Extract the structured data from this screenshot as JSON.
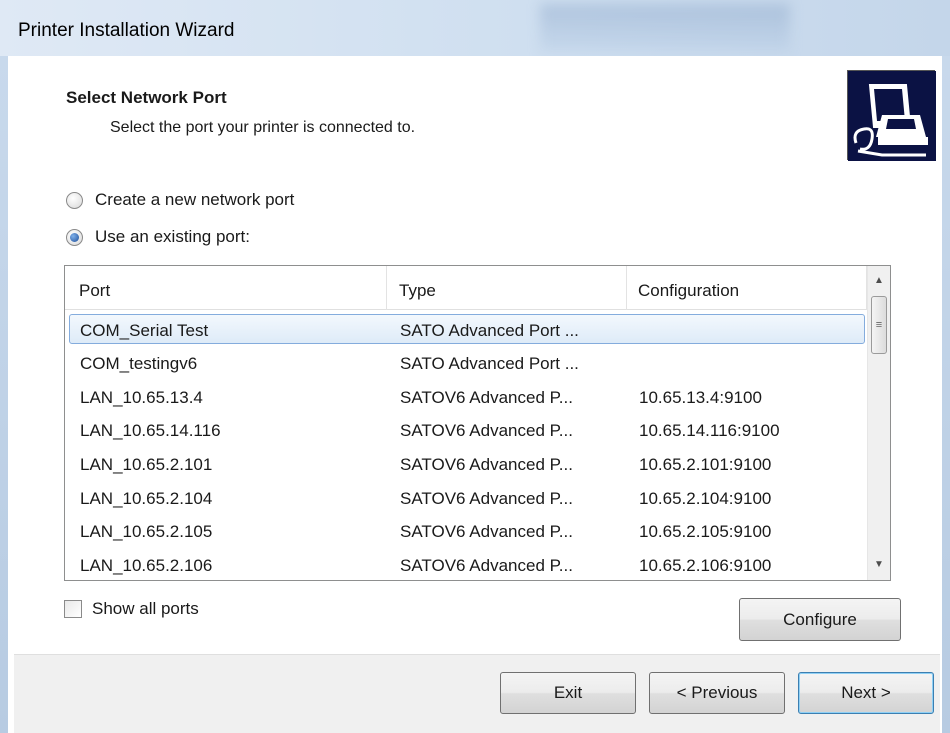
{
  "window": {
    "title": "Printer Installation Wizard"
  },
  "header": {
    "title": "Select Network Port",
    "subtitle": "Select the port your printer is connected to."
  },
  "options": {
    "create_new": "Create a new network port",
    "use_existing": "Use an existing port:",
    "selected": "use_existing"
  },
  "ports": {
    "columns": [
      "Port",
      "Type",
      "Configuration"
    ],
    "selected_index": 0,
    "rows": [
      {
        "port": "COM_Serial Test",
        "type": "SATO Advanced Port ...",
        "config": ""
      },
      {
        "port": "COM_testingv6",
        "type": "SATO Advanced Port ...",
        "config": ""
      },
      {
        "port": "LAN_10.65.13.4",
        "type": "SATOV6 Advanced P...",
        "config": "10.65.13.4:9100"
      },
      {
        "port": "LAN_10.65.14.116",
        "type": "SATOV6 Advanced P...",
        "config": "10.65.14.116:9100"
      },
      {
        "port": "LAN_10.65.2.101",
        "type": "SATOV6 Advanced P...",
        "config": "10.65.2.101:9100"
      },
      {
        "port": "LAN_10.65.2.104",
        "type": "SATOV6 Advanced P...",
        "config": "10.65.2.104:9100"
      },
      {
        "port": "LAN_10.65.2.105",
        "type": "SATOV6 Advanced P...",
        "config": "10.65.2.105:9100"
      },
      {
        "port": "LAN_10.65.2.106",
        "type": "SATOV6 Advanced P...",
        "config": "10.65.2.106:9100"
      }
    ]
  },
  "show_all_ports": {
    "label": "Show all ports",
    "checked": false
  },
  "buttons": {
    "configure": "Configure",
    "exit": "Exit",
    "previous": "< Previous",
    "next": "Next >"
  },
  "icons": {
    "header": "printer-computer-icon",
    "scroll_up": "scroll-up-arrow-icon",
    "scroll_down": "scroll-down-arrow-icon",
    "scroll_grip": "scroll-grip-icon"
  },
  "colors": {
    "selection_border": "#84acdd",
    "header_icon_bg": "#0b1244"
  }
}
